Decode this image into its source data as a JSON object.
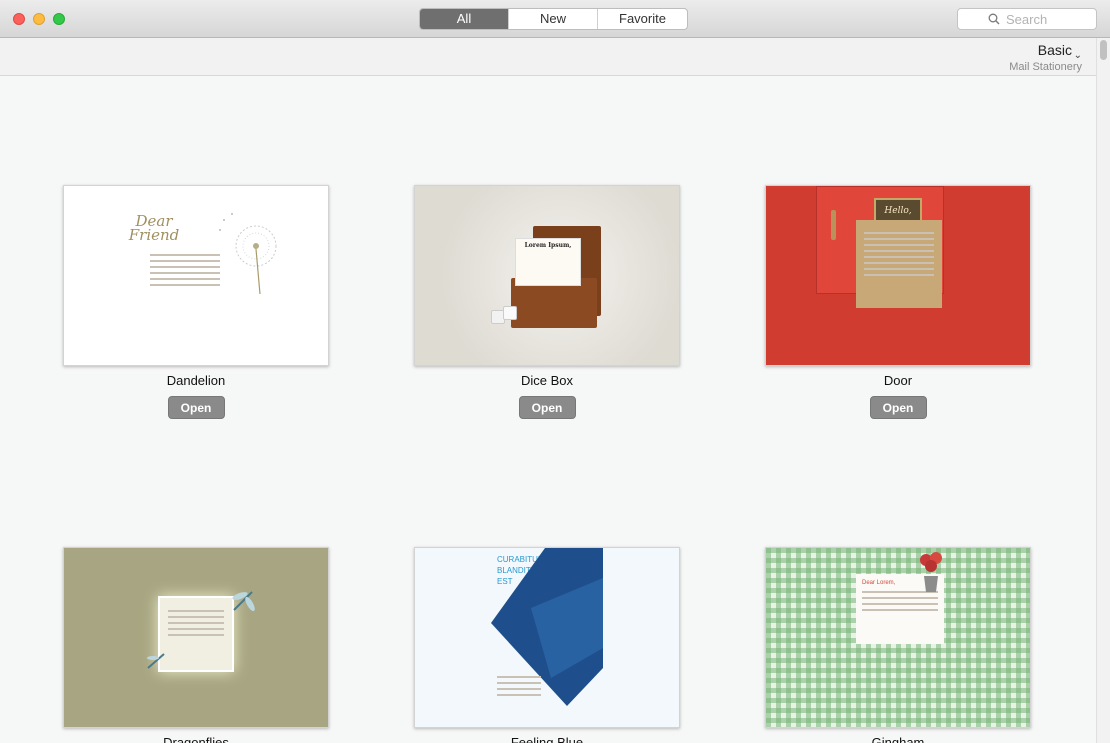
{
  "window": {
    "tabs": [
      "All",
      "New",
      "Favorite"
    ],
    "active_tab": "All",
    "search": {
      "placeholder": "Search"
    }
  },
  "category": {
    "name": "Basic",
    "subtitle": "Mail Stationery"
  },
  "cards": [
    {
      "name": "Dandelion",
      "open_label": "Open",
      "preview_title": "Dear Friend"
    },
    {
      "name": "Dice Box",
      "open_label": "Open",
      "preview_title": "Lorem Ipsum,"
    },
    {
      "name": "Door",
      "open_label": "Open",
      "preview_title": "Hello,"
    },
    {
      "name": "Dragonflies"
    },
    {
      "name": "Feeling Blue",
      "preview_title": "CURABITUR BLANDIT EST"
    },
    {
      "name": "Gingham",
      "preview_title": "Dear Lorem,"
    }
  ],
  "colors": {
    "door_red": "#d03c30",
    "dragonflies_bg": "#a8a682",
    "feeling_blue": "#1e4f8c",
    "gingham_green": "#8cc08e",
    "button_gray": "#8a8a8a"
  }
}
